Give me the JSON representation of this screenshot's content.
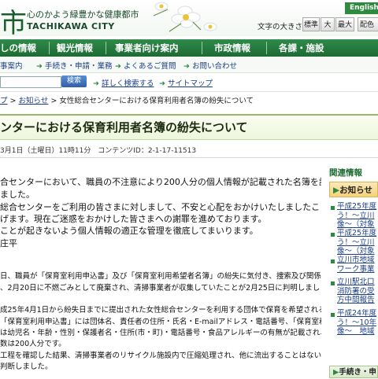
{
  "header": {
    "logo_char": "市",
    "tagline": "心のかよう緑豊かな健康都市",
    "city_en": "TACHIKAWA CITY",
    "english_label": "English",
    "font_size_label": "文字の大きさ",
    "font_size_buttons": [
      "標準",
      "大",
      "最大"
    ],
    "color_label": "配色変"
  },
  "nav": {
    "items": [
      "しの情報",
      "観光情報",
      "事業者向け案内",
      "市政情報",
      "各課・施設"
    ]
  },
  "subnav": {
    "items": [
      "事案内",
      "手続き・申請・業務",
      "よくあるご質問",
      "お問い合わせ",
      "詳しく検索する",
      "サイトマップ"
    ]
  },
  "search": {
    "button_label": "検索"
  },
  "breadcrumb": {
    "items": [
      "プ",
      "お知らせ",
      "女性総合センターにおける保育利用者名簿の紛失について"
    ],
    "separator": ">"
  },
  "page": {
    "title": "ンターにおける保育利用者名簿の紛失について",
    "meta_date": "3月1日（土曜日）11時11分",
    "meta_content_id_label": "コンテンツID：",
    "meta_content_id": "2-1-17-11513"
  },
  "body": {
    "lead_lines": [
      "合センターにおいて、職員の不注意により200人分の個人情報が記載された名簿を誤って廃",
      "ました。",
      "総合センターをご利用の皆さまに対しまして、不安と心配をおかけいたしましたことについて",
      "げます。現在ご迷惑をおかけした皆さまへの謝罪を進めております。",
      "ことが起きないよう個人情報の適正な管理を徹底してまいります。",
      "庄平"
    ],
    "detail_lines": [
      "日、職員が「保育室利用申込書」及び「保育室利用希望者名簿」の紛失に気付き、捜索及び関係者",
      "、2月20日に不燃ごみとして廃棄され、清掃事業者が収集していたことが2月25日に判明しまし",
      "成25年4月1日から紛失日までに提出された女性総合センターを利用する団体で保育を希望される",
      "「保育室利用申込書」には団体名、責任者の住所・氏名・E-mailアドレス・電話番号、「保育室利",
      "は幼児名・年齢・性別・保護者名・住所(市・町)・電話番号・食品アレルギーの有無が記載され、現",
      "数は200人分です。",
      "工程を確認した結果、清掃事業者のリサイクル施設内で圧縮処理され、他に流出することはない",
      "判断しました。"
    ]
  },
  "sidebar": {
    "related_label": "関連情報",
    "notice_label": "お知らせ",
    "items": [
      [
        "平成25年度",
        "う！～立川",
        "像～（対象"
      ],
      [
        "平成25年度",
        "う！～立川",
        "像～（対象"
      ],
      [
        "立川市地域",
        "ワーク事業"
      ],
      [
        "立川駅北口",
        "消防署の受",
        "方中間報告"
      ],
      [
        "平成24年度",
        "う！～10年",
        "像～　地域"
      ]
    ],
    "procedure_label": "手続き・申"
  },
  "colors": {
    "nav_green": "#2d8a3e",
    "link_blue": "#1a3e8a",
    "notice_yellow": "#f4d27a"
  }
}
